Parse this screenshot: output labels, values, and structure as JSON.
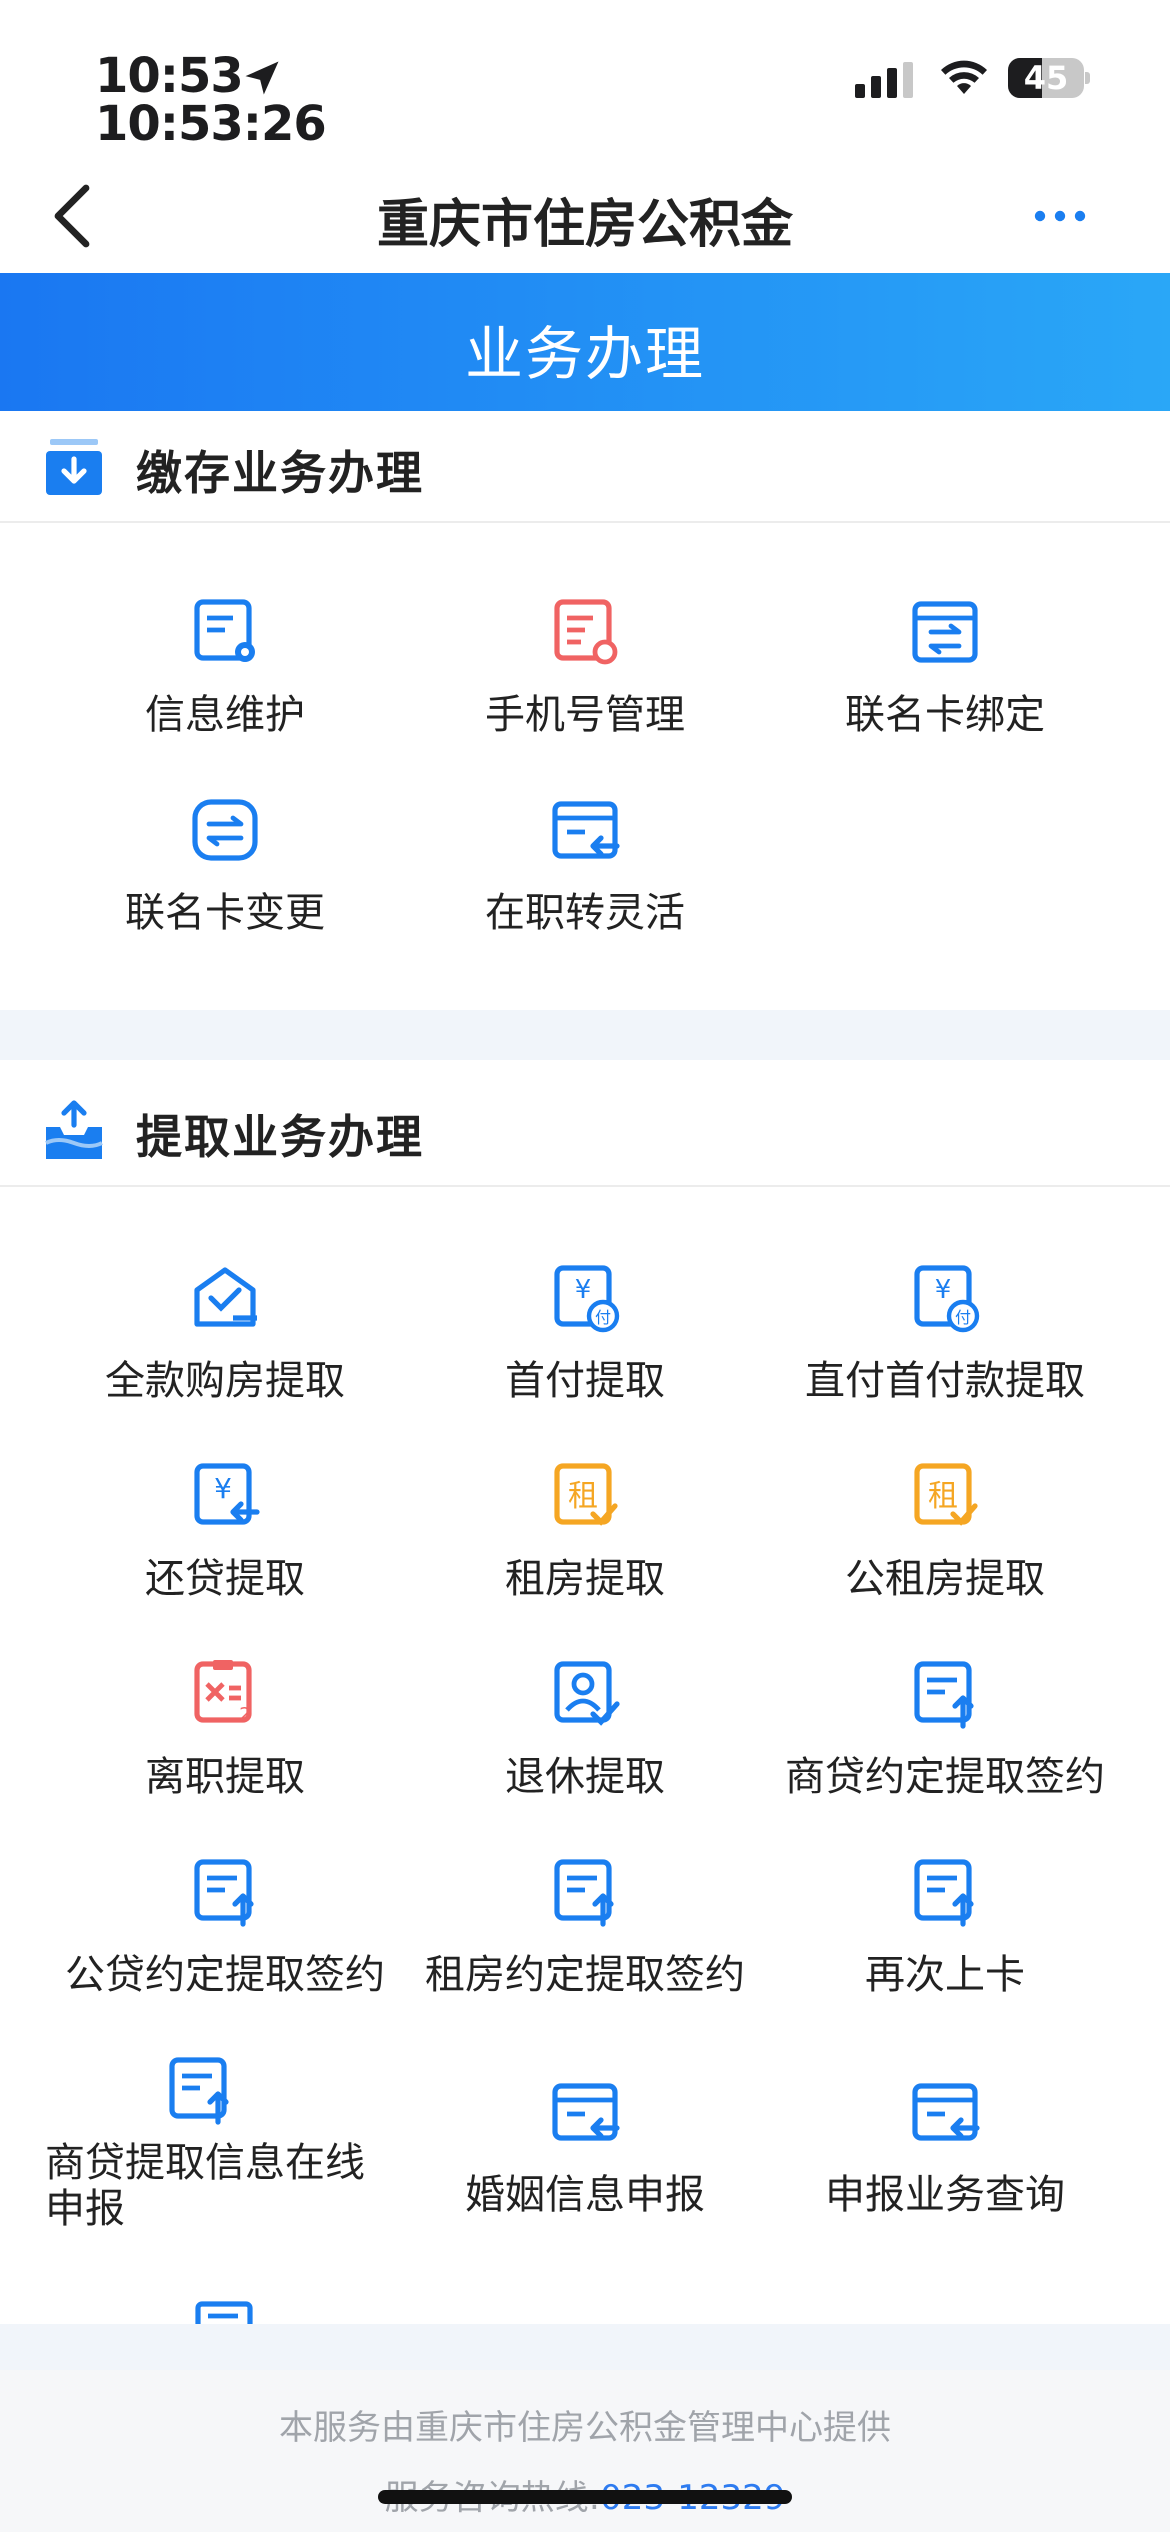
{
  "status_bar": {
    "time": "10:53",
    "time_seconds": "10:53:26",
    "battery": "45",
    "battery_level": 0.45
  },
  "nav": {
    "title": "重庆市住房公积金"
  },
  "banner": {
    "title": "业务办理"
  },
  "sections": {
    "deposit": {
      "title": "缴存业务办理",
      "items": [
        {
          "label": "信息维护",
          "icon": "doc-gear-icon",
          "color": "#1a7ef0"
        },
        {
          "label": "手机号管理",
          "icon": "doc-refresh-icon",
          "color": "#f06363"
        },
        {
          "label": "联名卡绑定",
          "icon": "card-swap-icon",
          "color": "#1a7ef0"
        },
        {
          "label": "联名卡变更",
          "icon": "card-change-icon",
          "color": "#1a7ef0"
        },
        {
          "label": "在职转灵活",
          "icon": "card-return-icon",
          "color": "#1a7ef0"
        }
      ]
    },
    "withdraw": {
      "title": "提取业务办理",
      "items": [
        {
          "label": "全款购房提取",
          "icon": "house-check-icon",
          "color": "#1a7ef0"
        },
        {
          "label": "首付提取",
          "icon": "yen-pay-icon",
          "color": "#1a7ef0"
        },
        {
          "label": "直付首付款提取",
          "icon": "yen-pay-icon",
          "color": "#1a7ef0"
        },
        {
          "label": "还贷提取",
          "icon": "yen-return-icon",
          "color": "#1a7ef0"
        },
        {
          "label": "租房提取",
          "icon": "rent-doc-icon",
          "color": "#f5a623"
        },
        {
          "label": "公租房提取",
          "icon": "rent-doc-icon",
          "color": "#f5a623"
        },
        {
          "label": "离职提取",
          "icon": "resign-doc-icon",
          "color": "#f06363"
        },
        {
          "label": "退休提取",
          "icon": "person-check-icon",
          "color": "#1a7ef0"
        },
        {
          "label": "商贷约定提取签约",
          "icon": "doc-upload-icon",
          "color": "#1a7ef0"
        },
        {
          "label": "公贷约定提取签约",
          "icon": "doc-upload-icon",
          "color": "#1a7ef0"
        },
        {
          "label": "租房约定提取签约",
          "icon": "doc-upload-icon",
          "color": "#1a7ef0"
        },
        {
          "label": "再次上卡",
          "icon": "doc-upload-icon",
          "color": "#1a7ef0"
        },
        {
          "label": "商贷提取信息在线申报",
          "icon": "doc-upload-icon",
          "color": "#1a7ef0"
        },
        {
          "label": "婚姻信息申报",
          "icon": "card-return-icon",
          "color": "#1a7ef0"
        },
        {
          "label": "申报业务查询",
          "icon": "card-return-icon",
          "color": "#1a7ef0"
        }
      ]
    }
  },
  "footer": {
    "line1": "本服务由重庆市住房公积金管理中心提供",
    "line2_prefix": "服务咨询热线:",
    "hotline": "023-12329"
  }
}
